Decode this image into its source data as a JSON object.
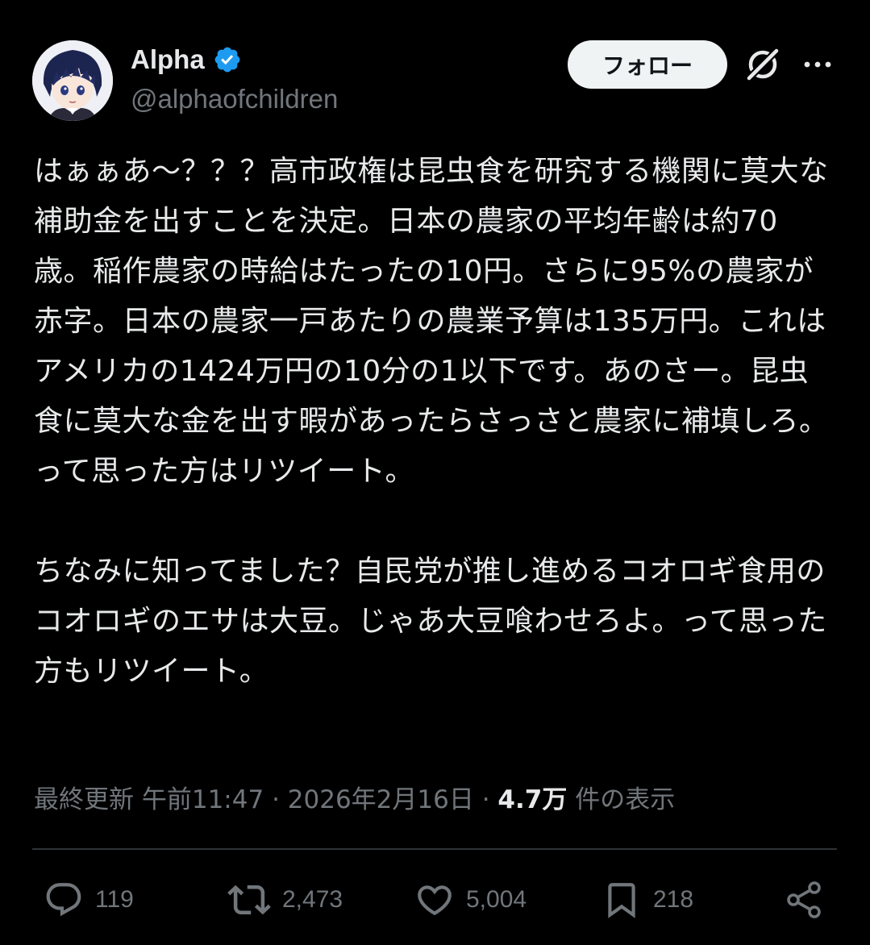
{
  "author": {
    "display_name": "Alpha",
    "handle": "@alphaofchildren",
    "verified": true,
    "avatar_icon": "anime-avatar-icon"
  },
  "header": {
    "follow_label": "フォロー",
    "grok_icon": "grok-icon",
    "more_icon": "more-icon"
  },
  "post": {
    "paragraphs": [
      "はぁぁあ〜？？？高市政権は昆虫食を研究する機関に莫大な補助金を出すことを決定。日本の農家の平均年齢は約70歳。稲作農家の時給はたったの10円。さらに95%の農家が赤字。日本の農家一戸あたりの農業予算は135万円。これはアメリカの1424万円の10分の1以下です。あのさー。昆虫食に莫大な金を出す暇があったらさっさと農家に補填しろ。って思った方はリツイート。",
      "ちなみに知ってました？自民党が推し進めるコオロギ食用のコオロギのエサは大豆。じゃあ大豆喰わせろよ。って思った方もリツイート。"
    ]
  },
  "meta": {
    "updated_label": "最終更新",
    "time": "午前11:47",
    "separator": "·",
    "date": "2026年2月16日",
    "views_count": "4.7万",
    "views_label": "件の表示"
  },
  "actions": {
    "replies": "119",
    "reposts": "2,473",
    "likes": "5,004",
    "bookmarks": "218"
  },
  "colors": {
    "background": "#000000",
    "text_primary": "#e7e9ea",
    "text_secondary": "#71767b",
    "verified_blue": "#1d9bf0",
    "divider": "#2f3336"
  }
}
